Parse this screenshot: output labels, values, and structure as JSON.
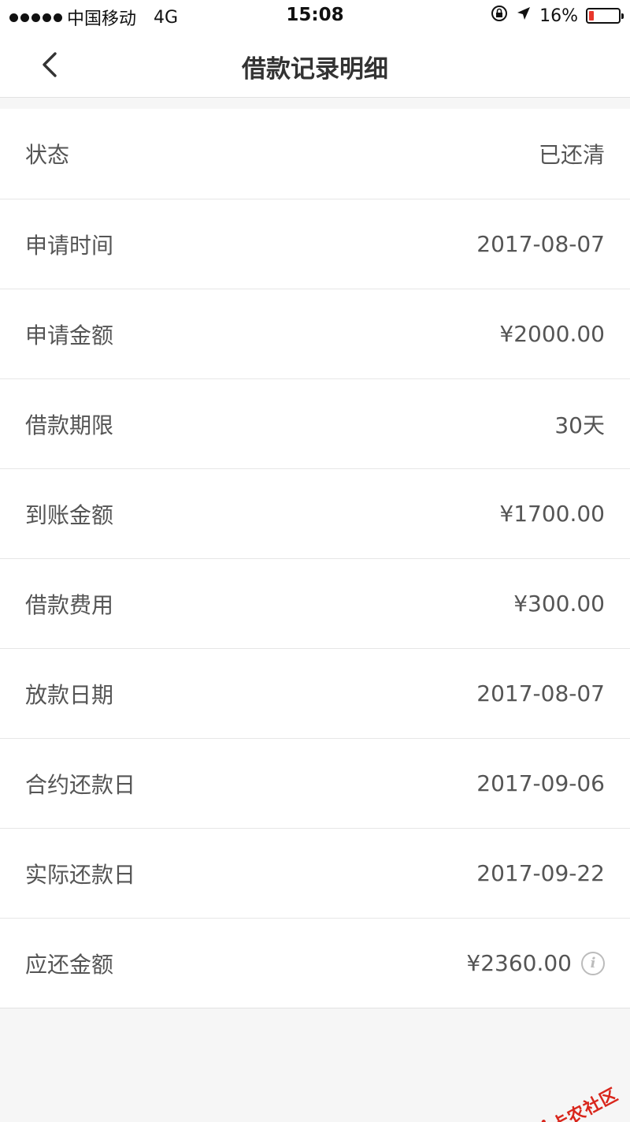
{
  "status_bar": {
    "carrier": "中国移动",
    "network": "4G",
    "time": "15:08",
    "battery": "16%",
    "battery_level": 0.16,
    "battery_color": "#e8362b"
  },
  "nav": {
    "title": "借款记录明细"
  },
  "details": [
    {
      "label": "状态",
      "value": "已还清"
    },
    {
      "label": "申请时间",
      "value": "2017-08-07"
    },
    {
      "label": "申请金额",
      "value": "¥2000.00"
    },
    {
      "label": "借款期限",
      "value": "30天"
    },
    {
      "label": "到账金额",
      "value": "¥1700.00"
    },
    {
      "label": "借款费用",
      "value": "¥300.00"
    },
    {
      "label": "放款日期",
      "value": "2017-08-07"
    },
    {
      "label": "合约还款日",
      "value": "2017-09-06"
    },
    {
      "label": "实际还款日",
      "value": "2017-09-22"
    },
    {
      "label": "应还金额",
      "value": "¥2360.00"
    }
  ],
  "icons": {
    "back": "chevron-left-icon",
    "info": "info-icon",
    "lock": "rotation-lock-icon",
    "location": "location-arrow-icon"
  },
  "watermark": {
    "text": "卡农社区"
  }
}
